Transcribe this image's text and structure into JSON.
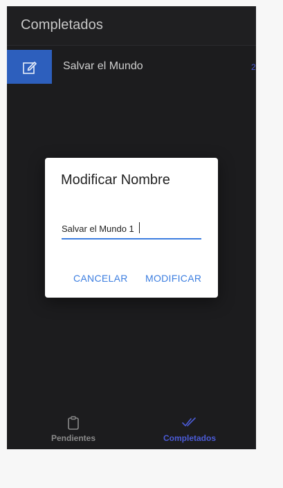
{
  "header": {
    "title": "Completados"
  },
  "list": {
    "items": [
      {
        "label": "Salvar el Mundo",
        "badge": "2"
      }
    ]
  },
  "dialog": {
    "title": "Modificar Nombre",
    "input_value": "Salvar el Mundo 1",
    "cancel_label": "CANCELAR",
    "modify_label": "MODIFICAR"
  },
  "tabs": [
    {
      "label": "Pendientes",
      "icon": "clipboard-icon",
      "active": false
    },
    {
      "label": "Completados",
      "icon": "done-all-icon",
      "active": true
    }
  ],
  "colors": {
    "background": "#1c1c1e",
    "accent_blue": "#3b7de0",
    "edit_button": "#2d5fbd",
    "active_tab": "#4b5bd6",
    "inactive_tab": "#8a8a8a"
  }
}
